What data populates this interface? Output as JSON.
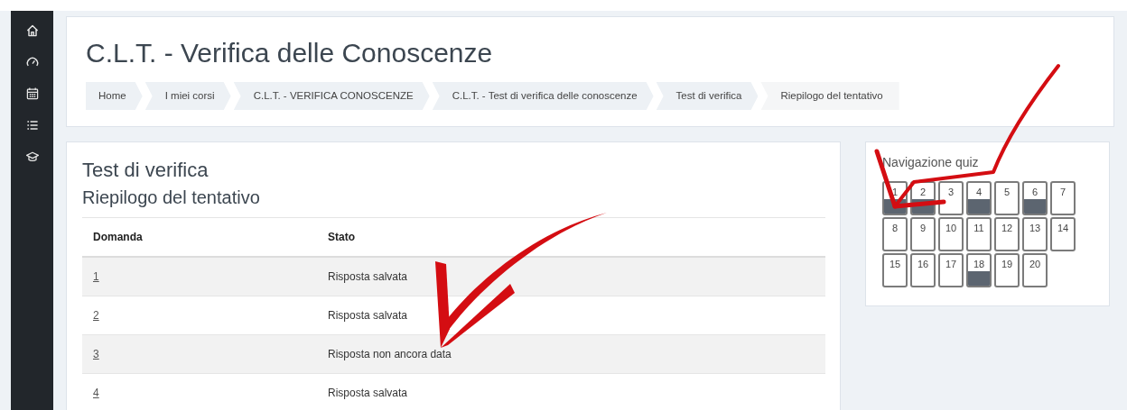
{
  "sidebar": {
    "items": [
      {
        "kind": "home"
      },
      {
        "kind": "dashboard"
      },
      {
        "kind": "calendar"
      },
      {
        "kind": "list"
      },
      {
        "kind": "courses"
      }
    ]
  },
  "header": {
    "title": "C.L.T. - Verifica delle Conoscenze",
    "breadcrumb": [
      "Home",
      "I miei corsi",
      "C.L.T. - VERIFICA CONOSCENZE",
      "C.L.T. - Test di verifica delle conoscenze",
      "Test di verifica",
      "Riepilogo del tentativo"
    ]
  },
  "main": {
    "title": "Test di verifica",
    "subtitle": "Riepilogo del tentativo",
    "table": {
      "columns": [
        "Domanda",
        "Stato"
      ],
      "rows": [
        {
          "question": "1",
          "status": "Risposta salvata"
        },
        {
          "question": "2",
          "status": "Risposta salvata"
        },
        {
          "question": "3",
          "status": "Risposta non ancora data"
        },
        {
          "question": "4",
          "status": "Risposta salvata"
        }
      ]
    }
  },
  "quiz_nav": {
    "title": "Navigazione quiz",
    "buttons": [
      {
        "label": "1",
        "answered": true
      },
      {
        "label": "2",
        "answered": true
      },
      {
        "label": "3",
        "answered": false
      },
      {
        "label": "4",
        "answered": true
      },
      {
        "label": "5",
        "answered": false
      },
      {
        "label": "6",
        "answered": true
      },
      {
        "label": "7",
        "answered": false
      },
      {
        "label": "8",
        "answered": false
      },
      {
        "label": "9",
        "answered": false
      },
      {
        "label": "10",
        "answered": false
      },
      {
        "label": "11",
        "answered": false
      },
      {
        "label": "12",
        "answered": false
      },
      {
        "label": "13",
        "answered": false
      },
      {
        "label": "14",
        "answered": false
      },
      {
        "label": "15",
        "answered": false
      },
      {
        "label": "16",
        "answered": false
      },
      {
        "label": "17",
        "answered": false
      },
      {
        "label": "18",
        "answered": true
      },
      {
        "label": "19",
        "answered": false
      },
      {
        "label": "20",
        "answered": false
      }
    ]
  }
}
